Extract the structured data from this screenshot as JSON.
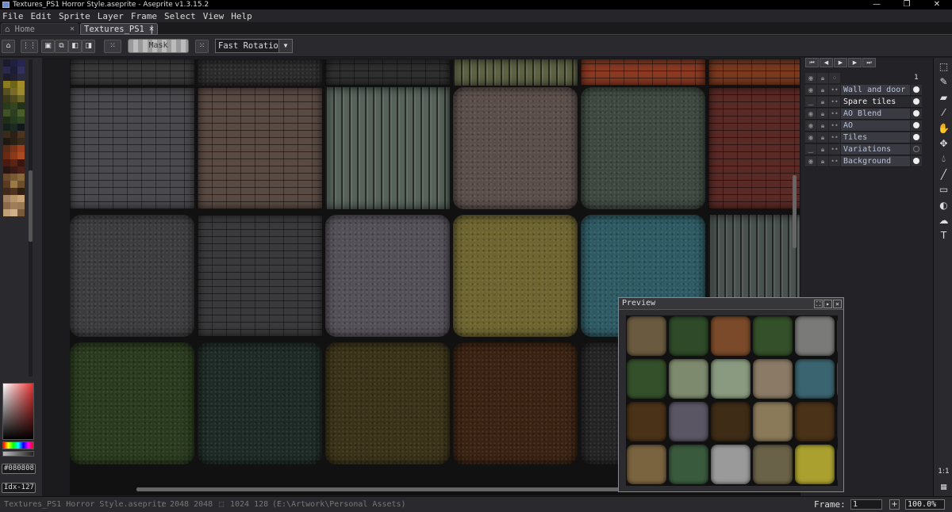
{
  "window": {
    "title": "Textures_PS1 Horror Style.aseprite - Aseprite v1.3.15.2",
    "controls": [
      "—",
      "❐",
      "✕"
    ]
  },
  "menu": [
    "File",
    "Edit",
    "Sprite",
    "Layer",
    "Frame",
    "Select",
    "View",
    "Help"
  ],
  "tabs": {
    "home": "Home",
    "file": "Textures_PS1 |",
    "close": "✕"
  },
  "contextbar": {
    "mask_label": "Mask",
    "rotation_value": "Fast Rotation"
  },
  "palette": {
    "colors": [
      "#1a1a2e",
      "#1f2040",
      "#262650",
      "#2a2848",
      "#1c1c35",
      "#303058",
      "#1d1b2a",
      "#22202e",
      "#2b2940",
      "#8a7a20",
      "#6e6418",
      "#a08c28",
      "#585020",
      "#7a6a28",
      "#9a8a30",
      "#3a3a18",
      "#4e4a1e",
      "#6a6226",
      "#2a3a1e",
      "#34461e",
      "#22321a",
      "#3e5226",
      "#2c3e22",
      "#4a5e2a",
      "#1e2c18",
      "#263a1e",
      "#304424",
      "#14201a",
      "#1a2a20",
      "#10181a",
      "#3a2a1a",
      "#2a2018",
      "#4a3420",
      "#1e1810",
      "#2a2014",
      "#382a1a",
      "#5a2a18",
      "#7a3418",
      "#9a4020",
      "#6a2a14",
      "#8a3a1a",
      "#a84a22",
      "#4a1a10",
      "#5c2212",
      "#3a1610",
      "#2a1410",
      "#3a1a14",
      "#4a2018",
      "#6a4a2a",
      "#7a5a32",
      "#8a6a3a",
      "#5a3a22",
      "#9a7a44",
      "#6e4e2c",
      "#3e2a1a",
      "#4e3420",
      "#2e2014",
      "#a08060",
      "#b8946a",
      "#c8a478",
      "#8a6a4a",
      "#a07e5c",
      "#9a7a56",
      "#c0a078",
      "#d0b088",
      "#7a5a3c"
    ]
  },
  "color": {
    "hex": "#080808",
    "index": "Idx-127"
  },
  "timeline": {
    "frame_nav": [
      "⏮",
      "◀",
      "▶",
      "▶",
      "⏭"
    ],
    "frame_number": "1",
    "layers": [
      {
        "name": "Wall and door",
        "visible": true,
        "cel": "filled"
      },
      {
        "name": "Spare tiles",
        "visible": false,
        "cel": "filled",
        "active": true
      },
      {
        "name": "AO Blend",
        "visible": true,
        "cel": "filled"
      },
      {
        "name": "AO",
        "visible": true,
        "cel": "filled"
      },
      {
        "name": "Tiles",
        "visible": true,
        "cel": "filled"
      },
      {
        "name": "Variations",
        "visible": false,
        "cel": "empty"
      },
      {
        "name": "Background",
        "visible": true,
        "cel": "filled"
      }
    ]
  },
  "tools": [
    "marquee-icon",
    "pencil-icon",
    "eraser-icon",
    "eyedropper-icon",
    "hand-icon",
    "move-icon",
    "bucket-icon",
    "line-icon",
    "rectangle-icon",
    "blur-icon",
    "smudge-icon",
    "text-icon"
  ],
  "preview": {
    "title": "Preview",
    "buttons": [
      "⛶",
      "▸",
      "✕"
    ]
  },
  "status": {
    "filename": "Textures_PS1 Horror Style.aseprite",
    "size": "2048 2048",
    "grid": "1024 128",
    "path": "(E:\\Artwork\\Personal Assets)",
    "frame_label": "Frame:",
    "frame_value": "1",
    "zoom": "100.0%"
  },
  "canvas_tiles": [
    {
      "color": "#3a3a3a",
      "kind": "brick"
    },
    {
      "color": "#2b2b2b",
      "kind": "noise"
    },
    {
      "color": "#2f2f30",
      "kind": "brick"
    },
    {
      "color": "#5e6244",
      "kind": "stripe"
    },
    {
      "color": "#8a3a22",
      "kind": "brick"
    },
    {
      "color": "#7a3a20",
      "kind": "brick"
    },
    {
      "color": "#4a4a4e",
      "kind": "brick"
    },
    {
      "color": "#5a4a44",
      "kind": "brick"
    },
    {
      "color": "#56625a",
      "kind": "stripe"
    },
    {
      "color": "#5a4e4a",
      "kind": "noise"
    },
    {
      "color": "#3e4840",
      "kind": "noise"
    },
    {
      "color": "#5a2a26",
      "kind": "brick"
    },
    {
      "color": "#3c3c3e",
      "kind": "noise"
    },
    {
      "color": "#3a3a3c",
      "kind": "brick"
    },
    {
      "color": "#545058",
      "kind": "noise"
    },
    {
      "color": "#6e6430",
      "kind": "noise"
    },
    {
      "color": "#2e5a64",
      "kind": "noise"
    },
    {
      "color": "#4a5250",
      "kind": "stripe"
    },
    {
      "color": "#2a3a1e",
      "kind": "noise"
    },
    {
      "color": "#1e2a26",
      "kind": "noise"
    },
    {
      "color": "#3a3218",
      "kind": "noise"
    },
    {
      "color": "#3a2212",
      "kind": "noise"
    },
    {
      "color": "#242424",
      "kind": "noise"
    },
    {
      "color": "#1a1a1a",
      "kind": "noise"
    }
  ],
  "preview_tiles": [
    "#6a5a40",
    "#2e4a28",
    "#7a4a2a",
    "#34502a",
    "#7a7a78",
    "#5a4a30",
    "#34502a",
    "#7e8a6e",
    "#8a9a80",
    "#8a7a66",
    "#3a6470",
    "#4a7a80",
    "#4a3218",
    "#5a5664",
    "#3e2c16",
    "#8a7a5a",
    "#4a3218",
    "#3a3218",
    "#7a6440",
    "#3a5a3e",
    "#9a9a9a",
    "#6a6248",
    "#aaa030",
    "#5a4a30"
  ]
}
